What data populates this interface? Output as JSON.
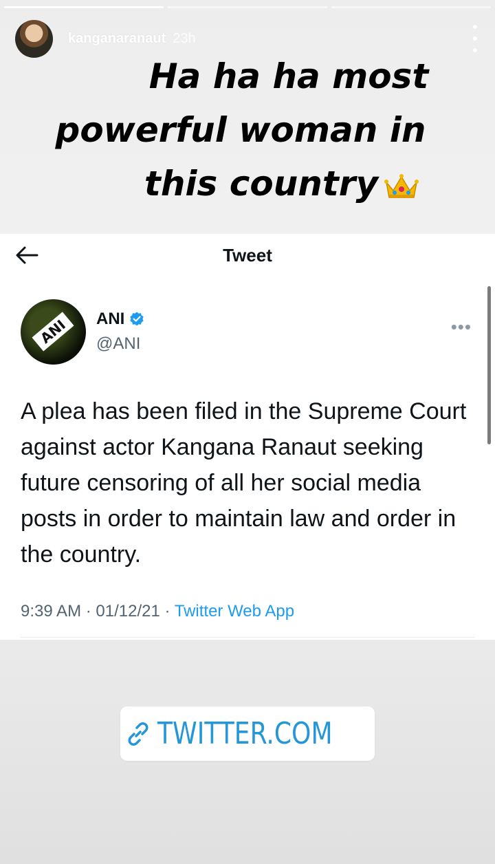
{
  "story": {
    "segments": 3,
    "username": "kanganaranaut",
    "time": "23h"
  },
  "caption": {
    "line1": "Ha ha ha most",
    "line2": "powerful woman in",
    "line3": "this country",
    "emoji": "crown-icon"
  },
  "tweet": {
    "header_title": "Tweet",
    "author_name": "ANI",
    "author_handle": "@ANI",
    "avatar_text": "ANI",
    "more": "•••",
    "text": "A plea has been filed in the Supreme Court against actor Kangana Ranaut seeking future censoring of all her social media posts in order to maintain law and order in the country.",
    "time": "9:39 AM",
    "date": "01/12/21",
    "separator": "·",
    "source": "Twitter Web App"
  },
  "link_sticker": {
    "label": "TWITTER.COM"
  },
  "colors": {
    "accent": "#1d9bf0",
    "link_sticker_text": "#2596d8",
    "verified_badge": "#1d9bf0"
  }
}
